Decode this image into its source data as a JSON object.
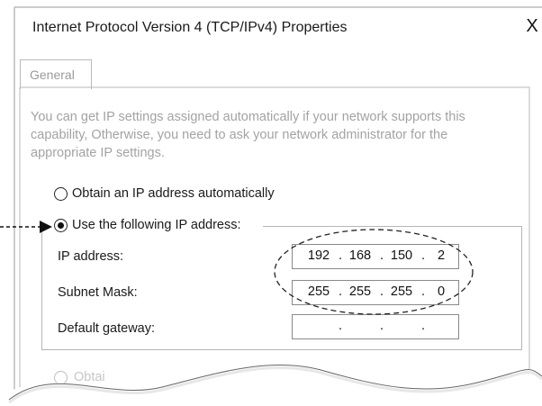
{
  "dialog": {
    "title": "Internet Protocol Version 4 (TCP/IPv4) Properties",
    "close_glyph": "X"
  },
  "tabs": [
    {
      "label": "General",
      "selected": true
    }
  ],
  "description": "You can get IP settings assigned automatically if your network supports this capability, Otherwise, you need to ask your network administrator for the appropriate IP settings.",
  "options": {
    "auto": {
      "label": "Obtain an IP address automatically",
      "selected": false
    },
    "manual": {
      "label": "Use the following IP address:",
      "selected": true
    },
    "dns_auto": {
      "label": "Obtai",
      "selected": false
    }
  },
  "fields": {
    "ip_address": {
      "label": "IP address:",
      "octets": [
        "192",
        "168",
        "150",
        "2"
      ]
    },
    "subnet_mask": {
      "label": "Subnet Mask:",
      "octets": [
        "255",
        "255",
        "255",
        "0"
      ]
    },
    "default_gateway": {
      "label": "Default gateway:",
      "octets": [
        "",
        "",
        "",
        ""
      ]
    }
  },
  "colors": {
    "text": "#1a1a1a",
    "muted_text": "#a3a3a3",
    "border": "#b5b5b5"
  }
}
